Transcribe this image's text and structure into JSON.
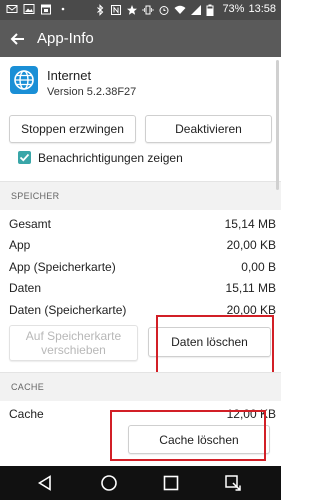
{
  "status_bar": {
    "battery": "73%",
    "time": "13:58"
  },
  "app_bar": {
    "title": "App-Info"
  },
  "app": {
    "name": "Internet",
    "version": "Version 5.2.38F27"
  },
  "buttons": {
    "force_stop": "Stoppen erzwingen",
    "disable": "Deaktivieren",
    "move_to_sd_line1": "Auf Speicherkarte",
    "move_to_sd_line2": "verschieben",
    "clear_data": "Daten löschen",
    "clear_cache": "Cache löschen"
  },
  "notifications": {
    "label": "Benachrichtigungen zeigen",
    "checked": true
  },
  "storage": {
    "header": "SPEICHER",
    "rows": [
      {
        "label": "Gesamt",
        "value": "15,14  MB"
      },
      {
        "label": "App",
        "value": "20,00  KB"
      },
      {
        "label": "App (Speicherkarte)",
        "value": "0,00  B"
      },
      {
        "label": "Daten",
        "value": "15,11  MB"
      },
      {
        "label": "Daten (Speicherkarte)",
        "value": "20,00  KB"
      }
    ]
  },
  "cache": {
    "header": "CACHE",
    "label": "Cache",
    "value": "12,00  KB"
  },
  "colors": {
    "accent": "#39a6a8",
    "highlight": "#d21f26",
    "app_bar": "#5a5a5a",
    "status_bar": "#4a4a4a"
  }
}
